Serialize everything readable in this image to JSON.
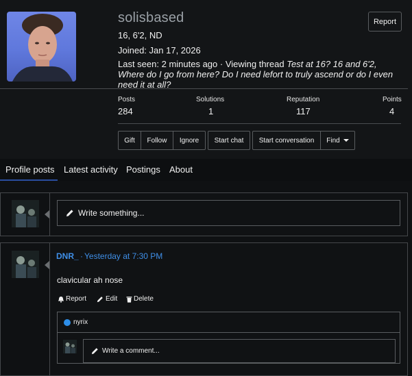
{
  "profile": {
    "username": "solisbased",
    "tagline": "16, 6'2, ND",
    "joined": "Joined: Jan 17, 2026",
    "last_seen_prefix": "Last seen: 2 minutes ago · Viewing thread",
    "last_seen_thread": "Test at 16? 16 and 6'2, Where do I go from here? Do I need lefort to truly ascend or do I even need it at all?",
    "report_label": "Report"
  },
  "stats": [
    {
      "label": "Posts",
      "value": "284"
    },
    {
      "label": "Solutions",
      "value": "1"
    },
    {
      "label": "Reputation",
      "value": "117"
    },
    {
      "label": "Points",
      "value": "4"
    }
  ],
  "actions": {
    "gift": "Gift",
    "follow": "Follow",
    "ignore": "Ignore",
    "start_chat": "Start chat",
    "start_conversation": "Start conversation",
    "find": "Find"
  },
  "tabs": [
    "Profile posts",
    "Latest activity",
    "Postings",
    "About"
  ],
  "composer": {
    "placeholder": "Write something..."
  },
  "post": {
    "author": "DNR_",
    "separator": "·",
    "time": "Yesterday at 7:30 PM",
    "body": "clavicular ah nose",
    "report_label": "Report",
    "edit_label": "Edit",
    "delete_label": "Delete",
    "reaction_user": "nyrix",
    "comment_placeholder": "Write a comment..."
  },
  "colors": {
    "accent_link": "#3f8fe8",
    "tab_underline": "#2a4ea0",
    "background": "#0d0f11"
  }
}
